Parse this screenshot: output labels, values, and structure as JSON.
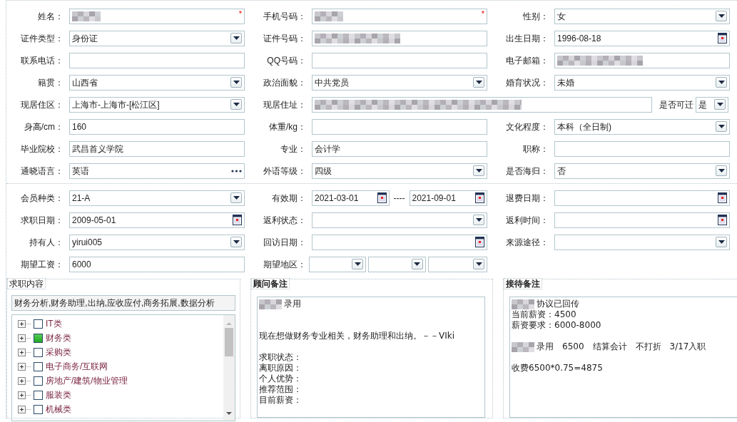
{
  "personal": {
    "rows": [
      [
        {
          "label": "姓名：",
          "kind": "text",
          "blurred": true,
          "required_mark": "*"
        },
        {
          "label": "手机号码：",
          "kind": "text",
          "blurred": true,
          "required_mark": "*"
        },
        {
          "label": "性别：",
          "kind": "select",
          "value": "女"
        }
      ],
      [
        {
          "label": "证件类型：",
          "kind": "select",
          "value": "身份证"
        },
        {
          "label": "证件号码：",
          "kind": "text",
          "blurred": true
        },
        {
          "label": "出生日期：",
          "kind": "date",
          "value": "1996-08-18"
        }
      ],
      [
        {
          "label": "联系电话：",
          "kind": "text"
        },
        {
          "label": "QQ号码：",
          "kind": "text"
        },
        {
          "label": "电子邮箱：",
          "kind": "text",
          "blurred": true
        }
      ],
      [
        {
          "label": "籍贯：",
          "kind": "select",
          "value": "山西省"
        },
        {
          "label": "政治面貌：",
          "kind": "select",
          "value": "中共党员"
        },
        {
          "label": "婚育状况：",
          "kind": "select",
          "value": "未婚"
        }
      ],
      [
        {
          "label": "现居住区：",
          "kind": "select",
          "value": "上海市-上海市-[松江区]"
        },
        {
          "label": "现居住址：",
          "kind": "wide-text",
          "blurred": true
        },
        {
          "label": "是否可迁",
          "kind": "small-select",
          "value": "是"
        }
      ],
      [
        {
          "label": "身高/cm：",
          "kind": "text",
          "value": "160"
        },
        {
          "label": "体重/kg：",
          "kind": "text"
        },
        {
          "label": "文化程度：",
          "kind": "select",
          "value": "本科（全日制)"
        }
      ],
      [
        {
          "label": "毕业院校：",
          "kind": "text",
          "value": "武昌首义学院"
        },
        {
          "label": "专业：",
          "kind": "text",
          "value": "会计学"
        },
        {
          "label": "职称：",
          "kind": "text"
        }
      ],
      [
        {
          "label": "通晓语言：",
          "kind": "picker",
          "value": "英语"
        },
        {
          "label": "外语等级：",
          "kind": "select",
          "value": "四级"
        },
        {
          "label": "是否海归：",
          "kind": "select",
          "value": "否"
        }
      ]
    ]
  },
  "membership": {
    "rows": [
      [
        {
          "label": "会员种类：",
          "kind": "select",
          "value": "21-A"
        },
        {
          "label": "有效期：",
          "kind": "date-range",
          "value": "2021-03-01",
          "separator": "----",
          "value_end": "2021-09-01"
        },
        {
          "label": "退费日期：",
          "kind": "date"
        }
      ],
      [
        {
          "label": "求职日期：",
          "kind": "date",
          "value": "2009-05-01"
        },
        {
          "label": "返利状态：",
          "kind": "select"
        },
        {
          "label": "返利时间：",
          "kind": "date"
        }
      ],
      [
        {
          "label": "持有人：",
          "kind": "select",
          "value": "yirui005"
        },
        {
          "label": "回访日期：",
          "kind": "date"
        },
        {
          "label": "来源途径：",
          "kind": "select"
        }
      ],
      [
        {
          "label": "期望工资：",
          "kind": "text",
          "value": "6000"
        },
        {
          "label": "期望地区：",
          "kind": "triple-select"
        }
      ]
    ]
  },
  "job_content": {
    "title": "求职内容",
    "summary": "财务分析,财务助理,出纳,应收应付,商务拓展,数据分析",
    "tree": [
      {
        "label": "IT类",
        "checked": false,
        "expanded": false
      },
      {
        "label": "财务类",
        "checked": true,
        "expanded": false
      },
      {
        "label": "采购类",
        "checked": false,
        "expanded": false
      },
      {
        "label": "电子商务/互联网",
        "checked": false,
        "expanded": false
      },
      {
        "label": "房地产/建筑/物业管理",
        "checked": false,
        "expanded": false
      },
      {
        "label": "服装类",
        "checked": false,
        "expanded": false
      },
      {
        "label": "机械类",
        "checked": false,
        "expanded": false
      }
    ]
  },
  "notes": [
    {
      "title": "顾问备注",
      "paragraphs": [
        [
          {
            "text": "录用",
            "blurred": true
          }
        ],
        [
          {
            "text": "现在想做财务专业相关，财务助理和出纳。－－VIki",
            "blurred": false
          }
        ],
        [
          {
            "text": "求职状态：",
            "blurred": false
          },
          {
            "text": "离职原因：",
            "blurred": false
          },
          {
            "text": "个人优势：",
            "blurred": false
          },
          {
            "text": "推荐范围：",
            "blurred": false
          },
          {
            "text": "目前薪资：",
            "blurred": false
          }
        ]
      ]
    },
    {
      "title": "接待备注",
      "paragraphs": [
        [
          {
            "text": "协议已回传",
            "blurred": true
          },
          {
            "text": "当前薪资：4500",
            "blurred": false
          },
          {
            "text": "薪资要求：6000-8000",
            "blurred": false
          }
        ],
        [
          {
            "text": "录用　6500　结算会计　不打折　3/17入职",
            "blurred": true
          }
        ],
        [
          {
            "text": "收费6500*0.75=4875",
            "blurred": false
          }
        ]
      ]
    }
  ]
}
